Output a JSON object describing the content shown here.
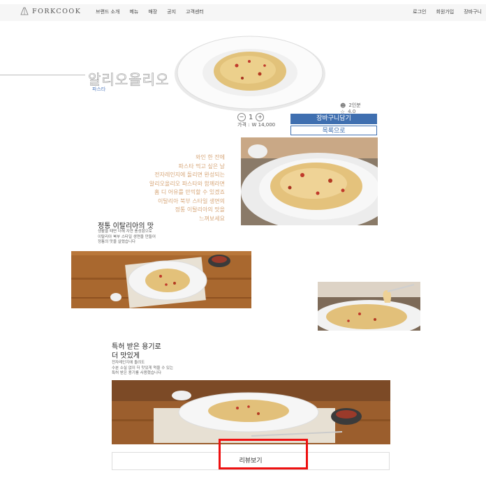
{
  "header": {
    "logo_text": "FORKCOOK",
    "nav": [
      "브랜드 소개",
      "메뉴",
      "매장",
      "공지",
      "고객센터"
    ],
    "util": [
      "로그인",
      "회원가입",
      "장바구니"
    ]
  },
  "hero": {
    "title": "알리오올리오",
    "category": "파스타"
  },
  "product": {
    "servings": "2인분",
    "rating": "4.0",
    "quantity": "1",
    "price_label": "가격 :",
    "price": "W 14,000",
    "cart_button": "장바구니담기",
    "list_button": "목록으로"
  },
  "intro_lines": [
    "와인 한 잔에",
    "파스타 먹고 싶은 날",
    "전자레인지에 돌리면 완성되는",
    "알리오올리오 파스타와 함께라면",
    "홈 디 어유를 만끽할 수 있겠죠",
    "이탈리아 북부 스타일 생면의",
    "정통 이탈리아의 맛을",
    "느껴보세요"
  ],
  "section1": {
    "title": "정통 이탈리아의 맛",
    "desc": [
      "생활을 때면 더해 자연 풍성함으로",
      "이탈리아 북부 스타일 생면을 만들어",
      "정통의 맛을 살렸습니다"
    ]
  },
  "section2": {
    "title_lines": [
      "특허 받은 용기로",
      "더 맛있게"
    ],
    "desc": [
      "전자레인지에 돌려도",
      "수분 소실 없이 더 맛있게 먹을 수 있는",
      "특허 받은 용기를 사용했습니다"
    ]
  },
  "review_button": "리뷰보기",
  "colors": {
    "accent_blue": "#3f6fb0",
    "intro_text": "#d7a77a",
    "highlight": "#ee1111"
  }
}
